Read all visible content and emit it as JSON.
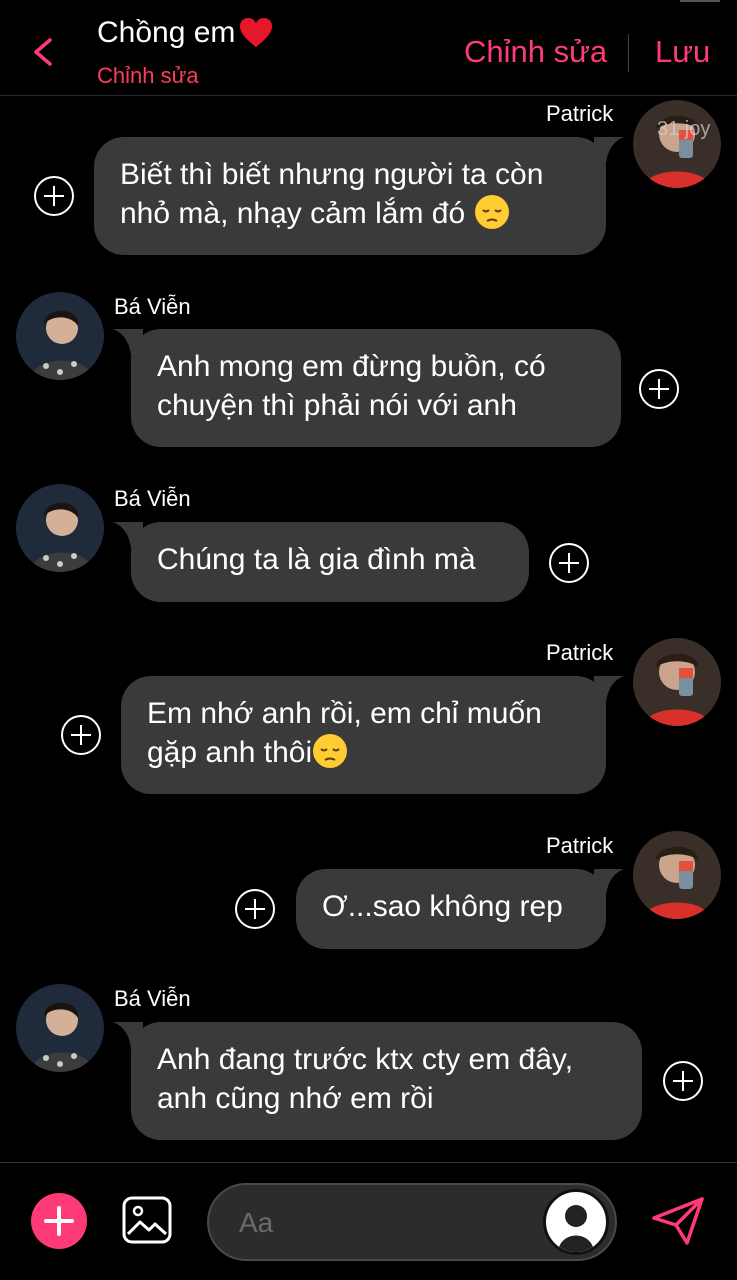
{
  "header": {
    "title": "Chồng em",
    "subtitle": "Chỉnh sửa",
    "edit_label": "Chỉnh sửa",
    "save_label": "Lưu"
  },
  "messages": [
    {
      "sender": "Patrick",
      "side": "right",
      "text_lines": [
        "Biết thì biết nhưng người ta còn",
        "nhỏ mà, nhạy cảm lắm đó"
      ],
      "emoji": "pensive-face",
      "avatar_badge": "31 joy"
    },
    {
      "sender": "Bá Viễn",
      "side": "left",
      "text_lines": [
        "Anh mong em đừng buồn, có",
        "chuyện thì phải nói với anh"
      ]
    },
    {
      "sender": "Bá Viễn",
      "side": "left",
      "text_lines": [
        "Chúng ta là gia đình mà"
      ]
    },
    {
      "sender": "Patrick",
      "side": "right",
      "text_lines": [
        "Em nhớ anh rồi, em chỉ muốn",
        "gặp anh thôi"
      ],
      "emoji": "pensive-face"
    },
    {
      "sender": "Patrick",
      "side": "right",
      "text_lines": [
        "Ơ...sao không rep"
      ]
    },
    {
      "sender": "Bá Viễn",
      "side": "left",
      "text_lines": [
        "Anh đang trước ktx cty em đây,",
        "anh cũng nhớ em rồi"
      ]
    }
  ],
  "composer": {
    "placeholder": "Aa"
  },
  "colors": {
    "accent": "#ff3b77",
    "bubble": "#3a3a3c",
    "background": "#000000"
  },
  "icons": [
    "back-chevron-icon",
    "heart-icon",
    "plus-circle-icon",
    "add-icon",
    "image-icon",
    "person-icon",
    "send-icon"
  ]
}
